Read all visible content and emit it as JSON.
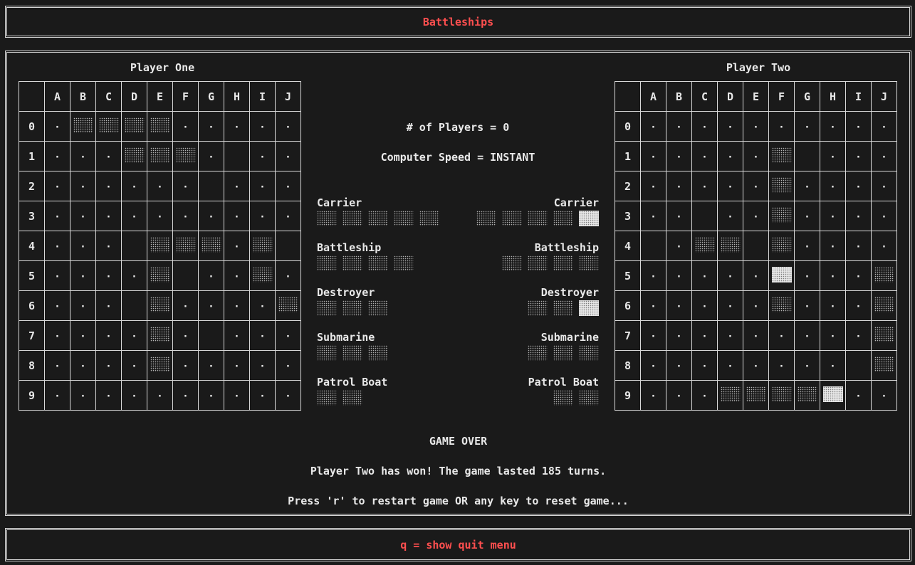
{
  "title": "Battleships",
  "footer": {
    "hint": "q = show quit menu"
  },
  "colors": {
    "accent": "#ff4f4f",
    "background": "#1a1a1a",
    "foreground": "#e8e8e8"
  },
  "columns": [
    "A",
    "B",
    "C",
    "D",
    "E",
    "F",
    "G",
    "H",
    "I",
    "J"
  ],
  "rows": [
    "0",
    "1",
    "2",
    "3",
    "4",
    "5",
    "6",
    "7",
    "8",
    "9"
  ],
  "player_one": {
    "label": "Player One",
    "grid": [
      ".SSSS.....",
      "...SSS._..",
      "......_...",
      "..........",
      "..._SSS.S_",
      "....S_..S.",
      "..._S....S.",
      "....S._...",
      "....S.....",
      ".........."
    ]
  },
  "player_two": {
    "label": "Player Two",
    "grid": [
      "..........",
      ".....S_...",
      ".....S....",
      ".._..S...",
      "_.SS_S....",
      ".....H...S",
      ".....S...S",
      ".........S",
      "........_S",
      "...SSSSH.."
    ]
  },
  "settings": {
    "players": "# of Players = 0",
    "speed": "Computer Speed = INSTANT"
  },
  "fleets": [
    {
      "name": "Carrier",
      "left": [
        "S",
        "S",
        "S",
        "S",
        "S"
      ],
      "right": [
        "S",
        "S",
        "S",
        "S",
        "H"
      ]
    },
    {
      "name": "Battleship",
      "left": [
        "S",
        "S",
        "S",
        "S"
      ],
      "right": [
        "S",
        "S",
        "S",
        "S"
      ]
    },
    {
      "name": "Destroyer",
      "left": [
        "S",
        "S",
        "S"
      ],
      "right": [
        "S",
        "S",
        "H"
      ]
    },
    {
      "name": "Submarine",
      "left": [
        "S",
        "S",
        "S"
      ],
      "right": [
        "S",
        "S",
        "S"
      ]
    },
    {
      "name": "Patrol Boat",
      "left": [
        "S",
        "S"
      ],
      "right": [
        "S",
        "S"
      ]
    }
  ],
  "status": {
    "headline": "GAME OVER",
    "result": "Player Two has won! The game lasted 185 turns.",
    "prompt": "Press 'r' to restart game OR any key to reset game..."
  }
}
